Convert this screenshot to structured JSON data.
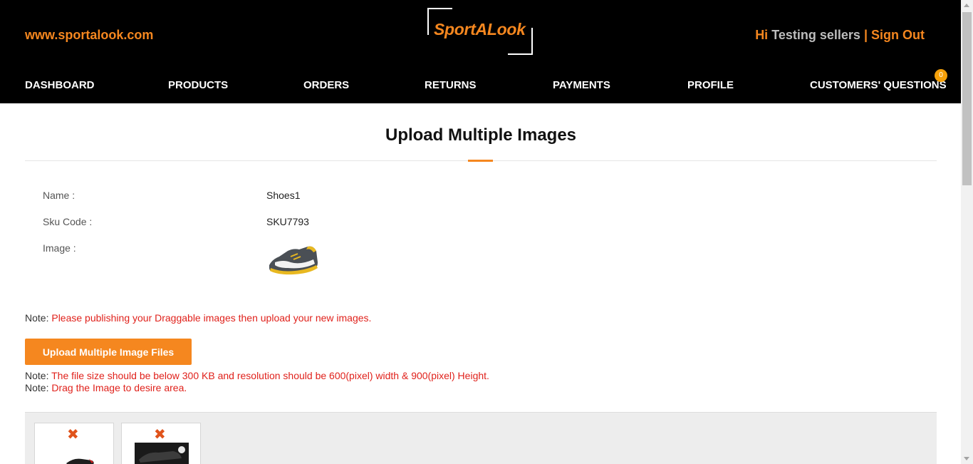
{
  "header": {
    "site_url": "www.sportalook.com",
    "logo_text": "SportALook",
    "greeting_hi": "Hi",
    "user_name": "Testing sellers",
    "separator": "|",
    "sign_out": "Sign Out"
  },
  "nav": {
    "items": [
      "DASHBOARD",
      "PRODUCTS",
      "ORDERS",
      "RETURNS",
      "PAYMENTS",
      "PROFILE",
      "CUSTOMERS' QUESTIONS"
    ],
    "questions_badge": "0"
  },
  "page": {
    "title": "Upload Multiple Images"
  },
  "product": {
    "name_label": "Name :",
    "name_value": "Shoes1",
    "sku_label": "Sku Code :",
    "sku_value": "SKU7793",
    "image_label": "Image :"
  },
  "notes": {
    "prefix": "Note:",
    "publish": "Please publishing your Draggable images then upload your new images.",
    "filesize": "The file size should be below 300 KB and resolution should be 600(pixel) width & 900(pixel) Height.",
    "drag": "Drag the Image to desire area."
  },
  "upload_button_label": "Upload Multiple Image Files",
  "gallery": {
    "delete_icon": "✖"
  },
  "colors": {
    "accent": "#f5871f",
    "header_bg": "#000000",
    "note_red": "#e0211b",
    "badge": "#f5a009"
  }
}
